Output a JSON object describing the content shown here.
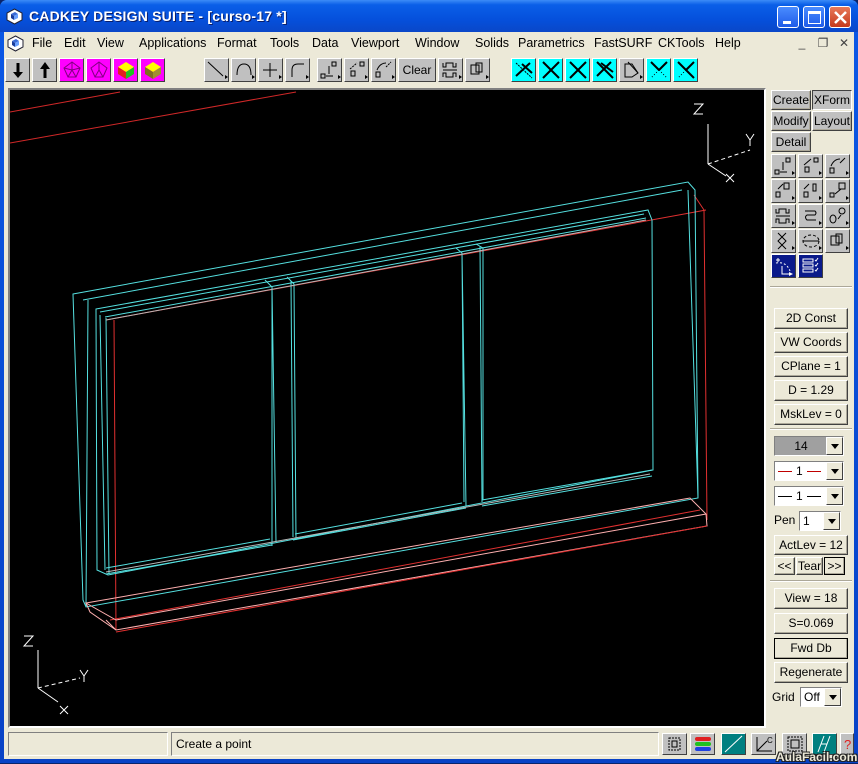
{
  "window": {
    "title": "CADKEY DESIGN SUITE - [curso-17 *]",
    "controls": [
      "minimize",
      "maximize",
      "close"
    ]
  },
  "menubar": {
    "items": [
      "File",
      "Edit",
      "View",
      "Applications",
      "Format",
      "Tools",
      "Data",
      "Viewport",
      "Window",
      "Solids",
      "Parametrics",
      "FastSURF",
      "CKTools",
      "Help"
    ],
    "mdi_controls": [
      "_",
      "❐",
      "✕"
    ]
  },
  "toolbar": {
    "buttons": [
      {
        "icon": "arrow-down-icon"
      },
      {
        "icon": "arrow-up-icon"
      },
      {
        "icon": "wire-solid-icon",
        "color": "#ff00ff"
      },
      {
        "icon": "wire-solid-icon",
        "color": "#ff00ff"
      },
      {
        "icon": "shaded-cube-icon",
        "color": "#ff00ff"
      },
      {
        "icon": "shaded-cube-icon",
        "color": "#ff00ff"
      },
      {
        "icon": "line-icon"
      },
      {
        "icon": "arc-icon"
      },
      {
        "icon": "point-icon"
      },
      {
        "icon": "fillet-icon"
      },
      {
        "icon": "xform-translate-icon"
      },
      {
        "icon": "xform-scale-icon"
      },
      {
        "icon": "xform-rotate-icon"
      },
      {
        "icon": "clear-button",
        "label": "Clear"
      },
      {
        "icon": "dimension-icon"
      },
      {
        "icon": "group-icon"
      },
      {
        "icon": "trim-dashed-icon",
        "color": "#00ffff"
      },
      {
        "icon": "trim-x-icon",
        "color": "#00ffff"
      },
      {
        "icon": "trim-x-icon",
        "color": "#00ffff"
      },
      {
        "icon": "trim-double-icon",
        "color": "#00ffff"
      },
      {
        "icon": "break-icon"
      },
      {
        "icon": "trim-dotted-icon",
        "color": "#00ffff"
      },
      {
        "icon": "trim-half-icon",
        "color": "#00ffff"
      }
    ]
  },
  "viewport": {
    "background": "#000000",
    "triad_top_right": {
      "labels": [
        "Z",
        "Y",
        "X"
      ]
    },
    "triad_bottom_left": {
      "labels": [
        "Z",
        "Y",
        "X"
      ]
    },
    "colors": {
      "frame": "#55e0e0",
      "edge": "#e03030",
      "sill": "#ffb0b0",
      "glass": "#c0c0c0"
    }
  },
  "sidebar": {
    "mode_tabs": [
      {
        "label": "Create",
        "pressed": false
      },
      {
        "label": "XForm",
        "pressed": true
      },
      {
        "label": "Modify",
        "pressed": false
      },
      {
        "label": "Layout",
        "pressed": false
      },
      {
        "label": "Detail",
        "pressed": false
      }
    ],
    "icon_grid": [
      "translate-icon",
      "scale-translate-icon",
      "rotate-copy-icon",
      "move-icon",
      "move-copy-icon",
      "transfer-icon",
      "stretch-icon",
      "round-copy-icon",
      "mirror-icon",
      "cross-icon",
      "circular-array-icon",
      "group-move-icon",
      "delay-icon",
      "checklist-icon"
    ],
    "status_buttons": [
      "2D Const",
      "VW Coords",
      "CPlane = 1",
      "D = 1.29",
      "MskLev = 0"
    ],
    "color_combo": "14",
    "linetype_combo": "1",
    "linewidth_combo": "1",
    "pen_label": "Pen",
    "pen_value": "1",
    "actlev": "ActLev = 12",
    "tear_prev": "<<",
    "tear": "Tear",
    "tear_next": ">>",
    "view_button": "View = 18",
    "scale_button": "S=0.069",
    "fwd_db": "Fwd Db",
    "regenerate": "Regenerate",
    "grid_label": "Grid",
    "grid_value": "Off"
  },
  "statusbar": {
    "left_pane": "",
    "prompt": "Create a point",
    "buttons": [
      "snap-window-icon",
      "color-bars-icon",
      "construction-line-icon",
      "cplane-axis-icon",
      "select-window-icon",
      "parallel-icon",
      "help-icon"
    ]
  },
  "watermark": "AulaFacil.com"
}
